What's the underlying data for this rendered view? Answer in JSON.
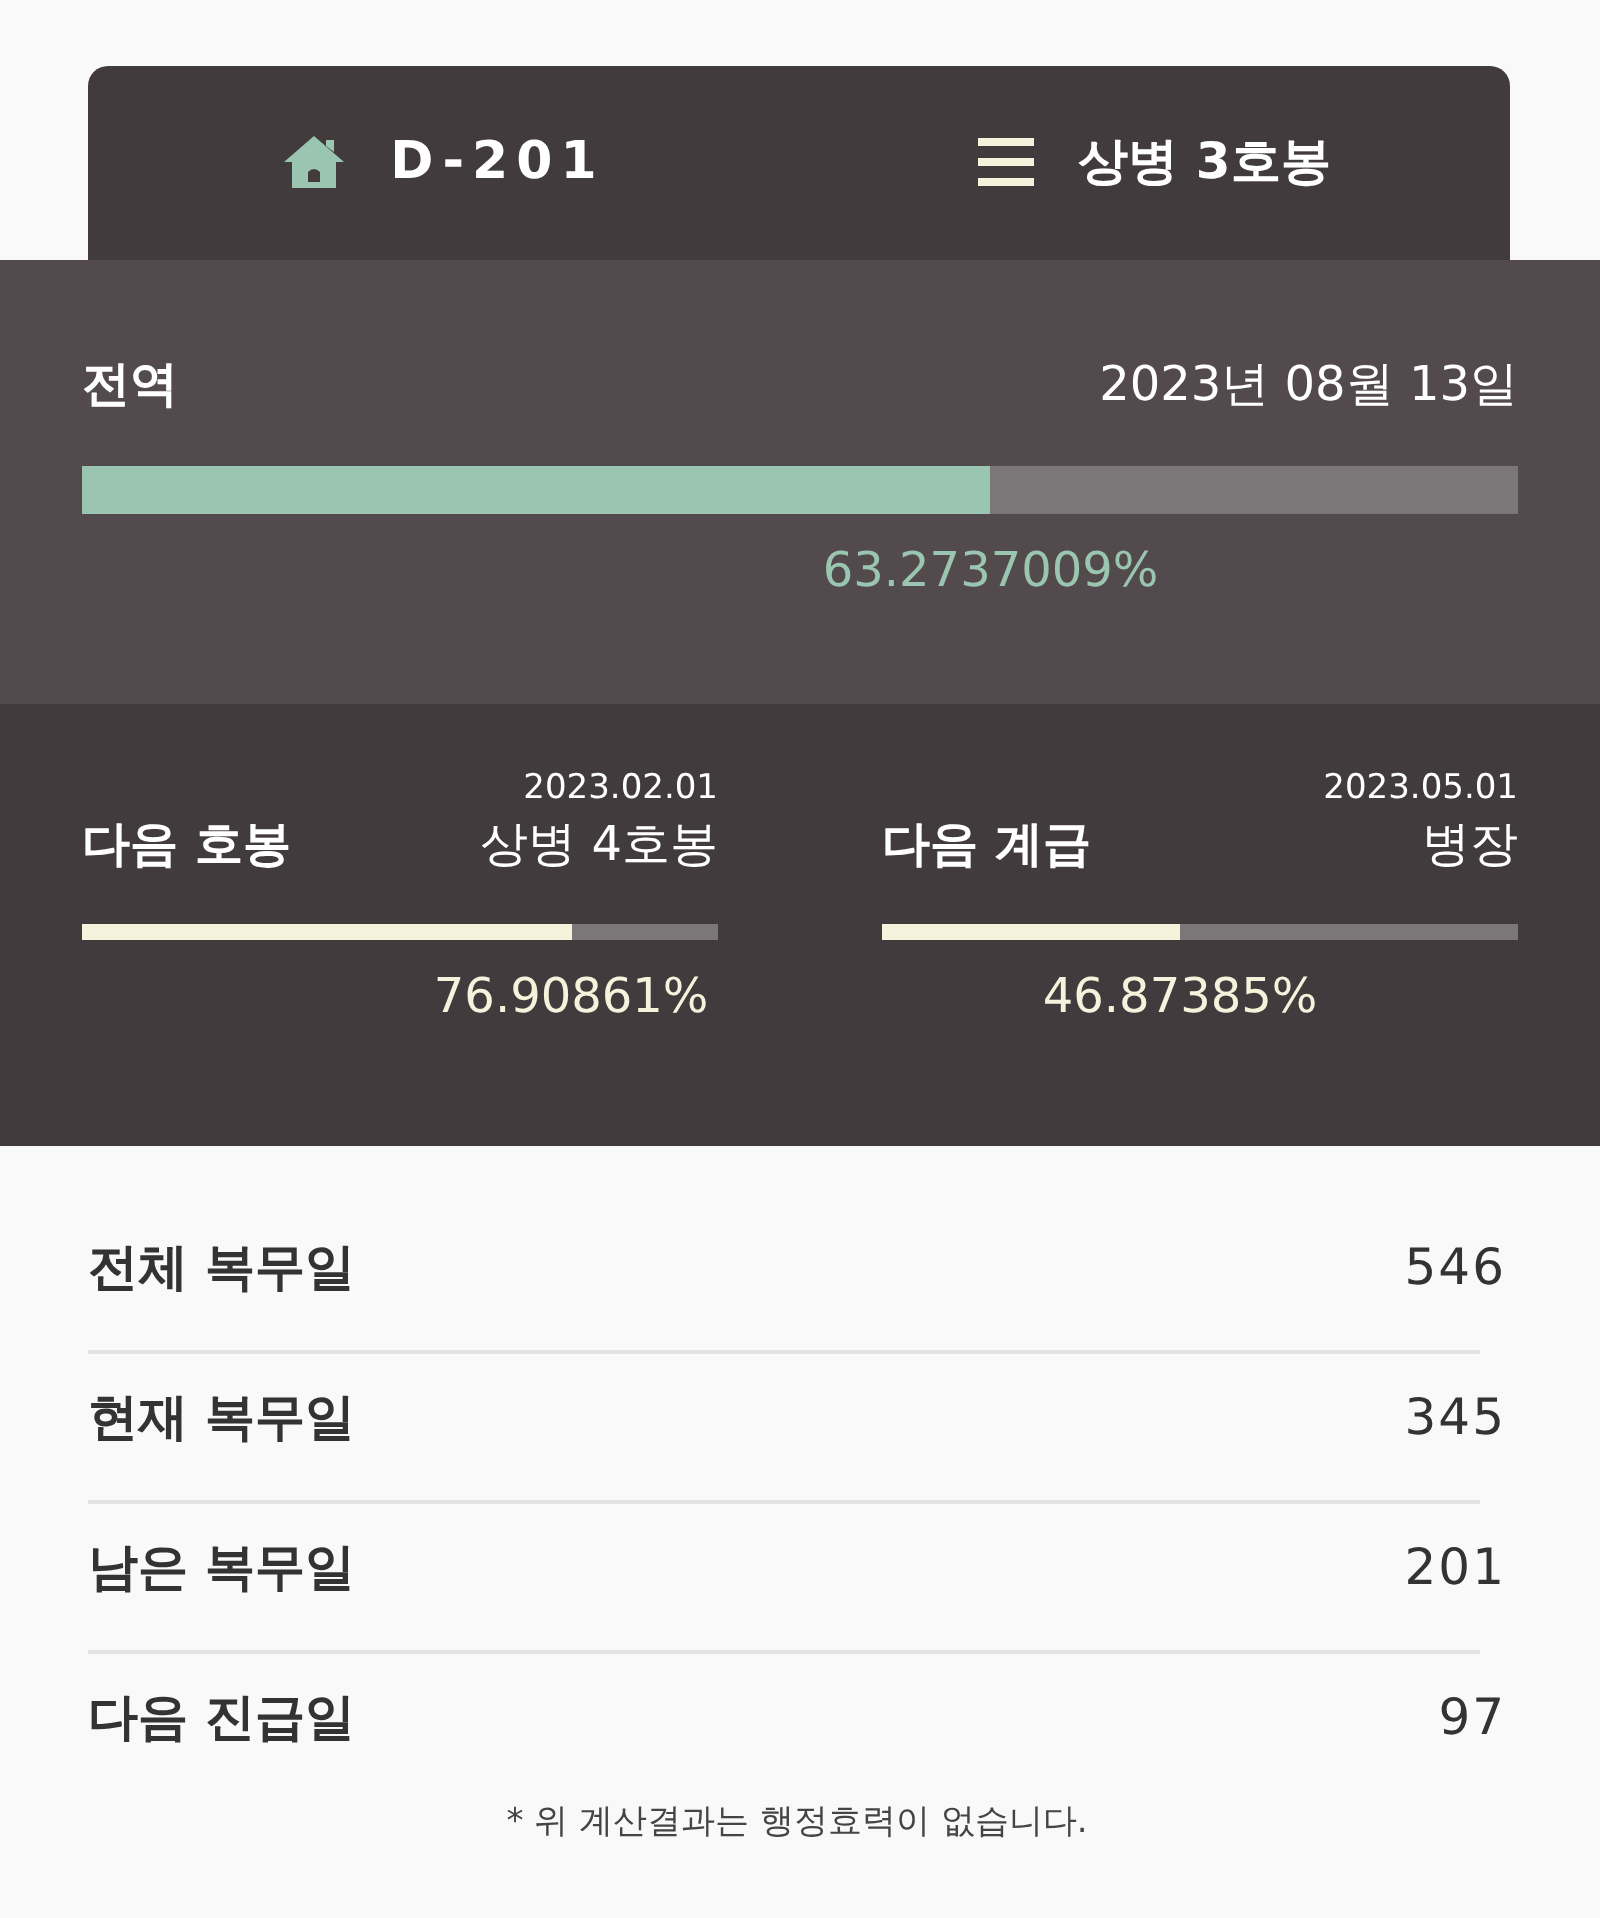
{
  "header": {
    "dday": "D-201",
    "rank": "상병 3호봉"
  },
  "discharge": {
    "title": "전역",
    "date": "2023년 08월 13일",
    "level": 0.632737009,
    "percent": "63.2737009%"
  },
  "next": [
    {
      "title": "다음 호봉",
      "date": "2023.02.01",
      "target": "상병 4호봉",
      "level": 0.7690861,
      "percent": "76.90861%"
    },
    {
      "title": "다음 계급",
      "date": "2023.05.01",
      "target": "병장",
      "level": 0.4687385,
      "percent": "46.87385%"
    }
  ],
  "stats": [
    {
      "label": "전체 복무일",
      "value": "546"
    },
    {
      "label": "현재 복무일",
      "value": "345"
    },
    {
      "label": "남은 복무일",
      "value": "201"
    },
    {
      "label": "다음 진급일",
      "value": "97"
    }
  ],
  "note": "* 위 계산결과는 행정효력이 없습니다."
}
